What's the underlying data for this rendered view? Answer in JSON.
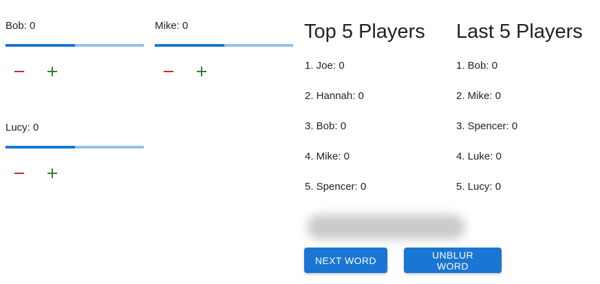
{
  "players": [
    {
      "label": "Bob: 0",
      "progress_percent": 50
    },
    {
      "label": "Mike: 0",
      "progress_percent": 50
    },
    {
      "label": "Lucy: 0",
      "progress_percent": 50
    }
  ],
  "top": {
    "title": "Top 5 Players",
    "items": [
      "1. Joe: 0",
      "2. Hannah: 0",
      "3. Bob: 0",
      "4. Mike: 0",
      "5. Spencer: 0"
    ]
  },
  "last": {
    "title": "Last 5 Players",
    "items": [
      "1. Bob: 0",
      "2. Mike: 0",
      "3. Spencer: 0",
      "4. Luke: 0",
      "5. Lucy: 0"
    ]
  },
  "buttons": {
    "next_word": "NEXT WORD",
    "unblur_word": "UNBLUR WORD"
  },
  "colors": {
    "primary": "#1976d2",
    "primary_light": "#94c0ec",
    "minus": "#c62828",
    "plus": "#2e7d32"
  },
  "icons": {
    "decrement": "minus-icon",
    "increment": "plus-icon"
  }
}
